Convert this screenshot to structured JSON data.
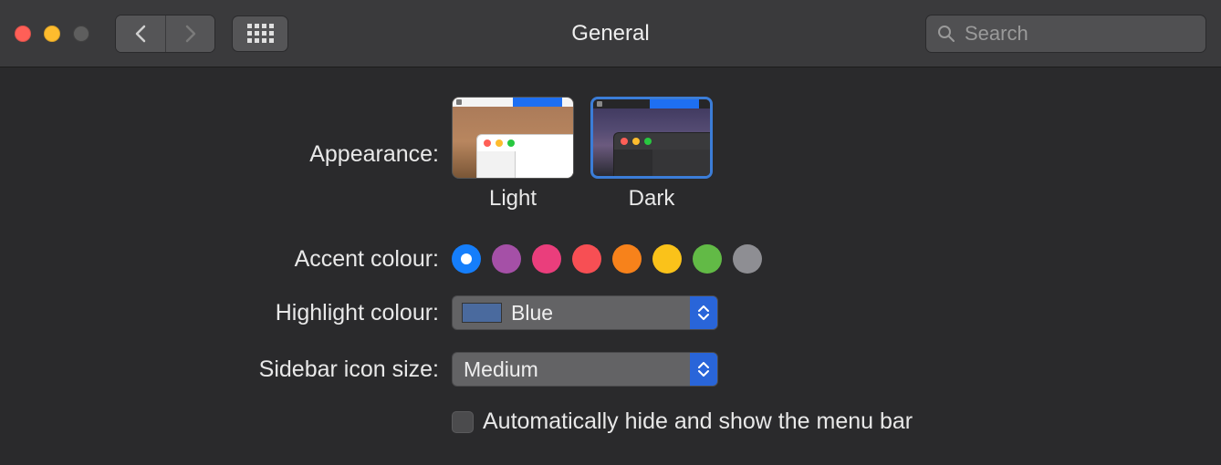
{
  "window": {
    "title": "General"
  },
  "toolbar": {
    "search_placeholder": "Search"
  },
  "appearance": {
    "label": "Appearance:",
    "options": [
      {
        "label": "Light"
      },
      {
        "label": "Dark"
      }
    ],
    "selected": "Dark"
  },
  "accent": {
    "label": "Accent colour:",
    "colors": [
      "#157efb",
      "#a550a7",
      "#ea3e7c",
      "#f74f54",
      "#f7821b",
      "#fac21a",
      "#62ba46",
      "#8e8e93"
    ],
    "selected_index": 0
  },
  "highlight": {
    "label": "Highlight colour:",
    "value": "Blue",
    "swatch": "#4a6a9e"
  },
  "sidebar": {
    "label": "Sidebar icon size:",
    "value": "Medium"
  },
  "menubar_checkbox": {
    "label": "Automatically hide and show the menu bar",
    "checked": false
  }
}
